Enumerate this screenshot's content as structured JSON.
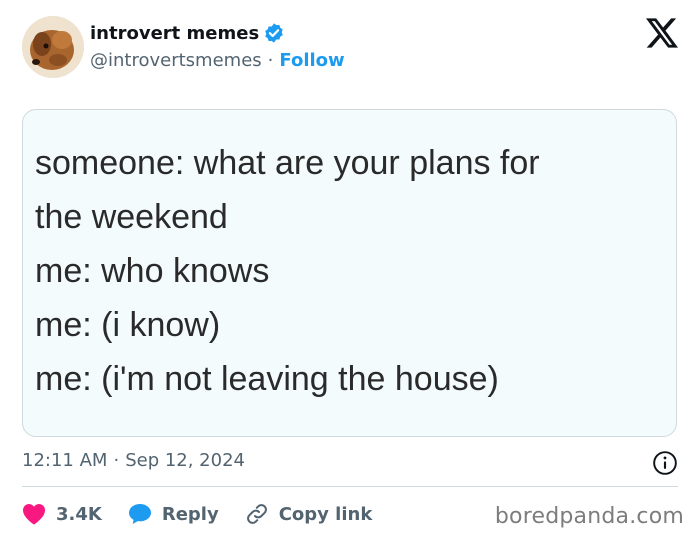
{
  "author": {
    "display_name": "introvert memes",
    "handle": "@introvertsmemes",
    "separator": "·",
    "follow_label": "Follow"
  },
  "post": {
    "meme_lines": [
      "someone: what are your plans for",
      "the weekend",
      "me: who knows",
      "me: (i know)",
      "me: (i'm not leaving the house)"
    ],
    "time": "12:11 AM",
    "date_separator": "·",
    "date": "Sep 12, 2024"
  },
  "actions": {
    "likes": "3.4K",
    "reply_label": "Reply",
    "copy_label": "Copy link"
  },
  "watermark": "boredpanda.com",
  "icons": {
    "verified": "verified-badge-icon",
    "logo": "x-logo-icon",
    "info": "info-icon",
    "heart": "heart-icon",
    "reply": "reply-bubble-icon",
    "link": "link-icon"
  },
  "colors": {
    "accent": "#1d9bf0",
    "heart": "#f91880",
    "secondary_text": "#536471",
    "card_bg": "#f3fbfc"
  }
}
